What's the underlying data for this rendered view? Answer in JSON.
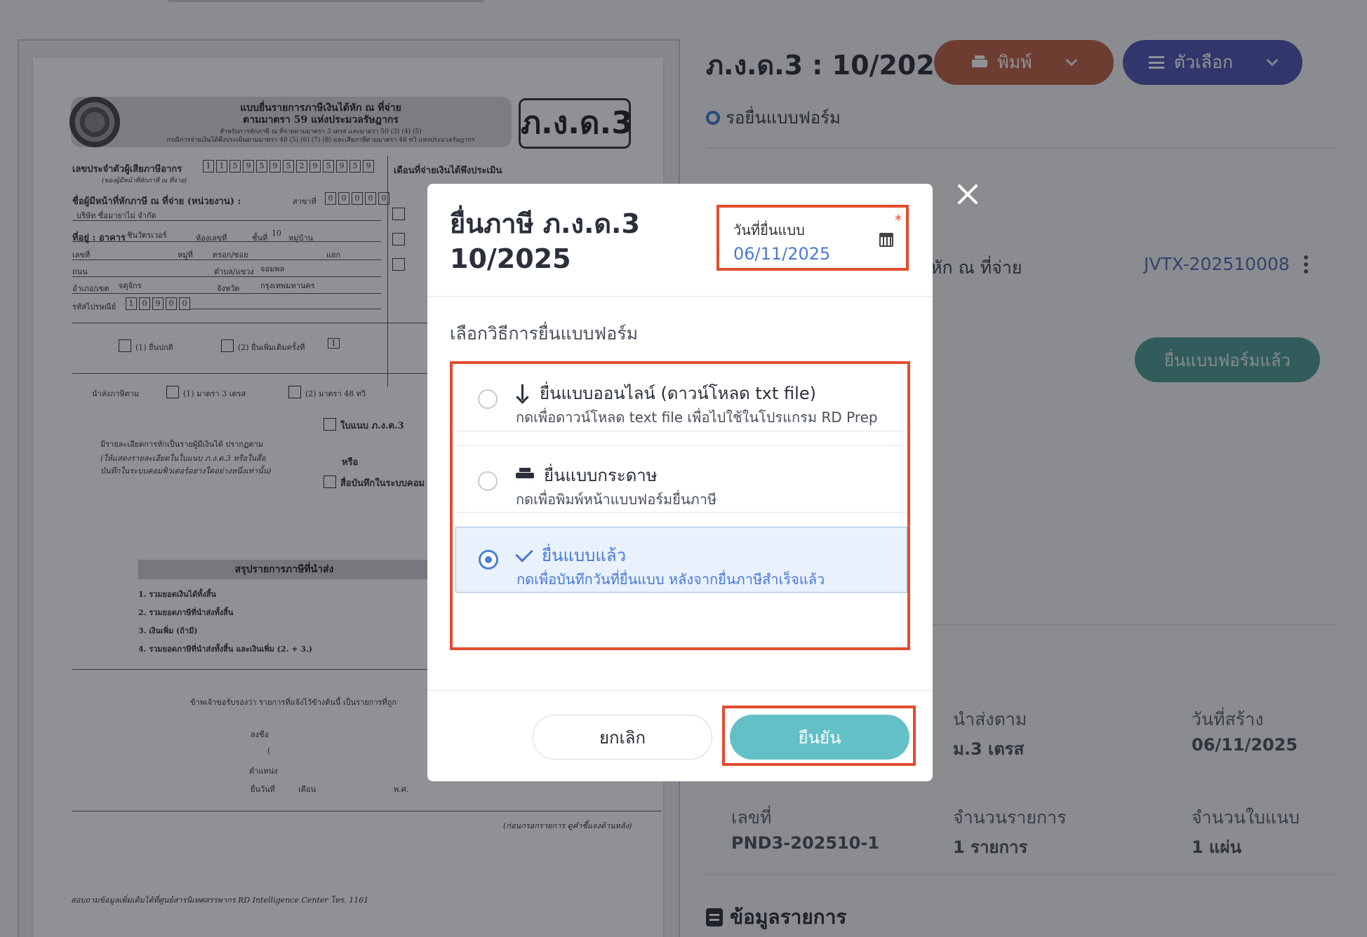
{
  "document": {
    "title_line1": "แบบยื่นรายการภาษีเงินได้หัก ณ ที่จ่าย",
    "title_line2": "ตามมาตรา 59 แห่งประมวลรัษฎากร",
    "sub_line1": "สำหรับการหักภาษี ณ ที่จ่ายตามมาตรา 3 เตรส และมาตรา 50 (3) (4) (5)",
    "sub_line2": "กรณีการจ่ายเงินได้พึงประเมินตามมาตรา 40 (5) (6) (7) (8) และเสียภาษีตามมาตรา 48 ทวิ แห่งประมวลรัษฎากร",
    "badge": "ภ.ง.ด.3",
    "taxid_label": "เลขประจำตัวผู้เสียภาษีอากร",
    "taxid_sub": "(ของผู้มีหน้าที่หักภาษี ณ ที่จ่าย)",
    "taxid_digits": [
      "1",
      "1",
      "5",
      "9",
      "5",
      "9",
      "5",
      "2",
      "9",
      "5",
      "9",
      "5",
      "9"
    ],
    "month_label": "เดือนที่จ่ายเงินได้พึงประเมิน",
    "payer_label": "ชื่อผู้มีหน้าที่หักภาษี ณ ที่จ่าย (หน่วยงาน) :",
    "branch_label": "สาขาที่",
    "branch_digits": [
      "0",
      "0",
      "0",
      "0",
      "0"
    ],
    "company_name": "บริษัท ซื่อมายาไม่ จำกัด",
    "address_label": "ที่อยู่ : อาคาร",
    "building": "ชินวัตรเวอร์",
    "room_label": "ห้องเลขที่",
    "floor_label": "ชั้นที่",
    "floor_value": "10",
    "village_label": "หมู่บ้าน",
    "no_label": "เลขที่",
    "moo_label": "หมู่ที่",
    "soi_label": "ตรอก/ซอย",
    "yaek_label": "แยก",
    "road_label": "ถนน",
    "subdistrict_label": "ตำบล/แขวง",
    "subdistrict_value": "จอมพล",
    "district_label": "อำเภอ/เขต",
    "district_value": "จตุจักร",
    "province_label": "จังหวัด",
    "province_value": "กรุงเทพมหานคร",
    "postcode_label": "รหัสไปรษณีย์",
    "postcode_digits": [
      "1",
      "0",
      "9",
      "0",
      "0"
    ],
    "normal_filing": "(1) ยื่นปกติ",
    "extra_filing": "(2) ยื่นเพิ่มเติมครั้งที่",
    "extra_count": "1",
    "remit_label": "นำส่งภาษีตาม",
    "remit_opt1": "(1) มาตรา 3 เตรส",
    "remit_opt2": "(2) มาตรา 48 ทวิ",
    "attach_label": "ใบแนบ ภ.ง.ด.3",
    "detail_line1": "มีรายละเอียดการหักเป็นรายผู้มีเงินได้ ปรากฏตาม",
    "detail_line2": "(ให้แสดงรายละเอียดในใบแนบ ภ.ง.ด.3 หรือในสื่อ",
    "detail_line3": "บันทึกในระบบคอมพิวเตอร์อย่างใดอย่างหนึ่งเท่านั้น)",
    "or_label": "หรือ",
    "media_label": "สื่อบันทึกในระบบคอม",
    "summary_title": "สรุปรายการภาษีที่นำส่ง",
    "sum1": "1. รวมยอดเงินได้ทั้งสิ้น",
    "sum2": "2. รวมยอดภาษีที่นำส่งทั้งสิ้น",
    "sum3": "3. เงินเพิ่ม (ถ้ามี)",
    "sum4": "4. รวมยอดภาษีที่นำส่งทั้งสิ้น และเงินเพิ่ม (2. + 3.)",
    "certify": "ข้าพเจ้าขอรับรองว่า รายการที่แจ้งไว้ข้างต้นนี้ เป็นรายการที่ถูก",
    "sign_label": "ลงชื่อ",
    "paren_open": "(",
    "position_label": "ตำแหน่ง",
    "date_label": "ยื่นวันที่",
    "month_word": "เดือน",
    "year_word": "พ.ศ.",
    "footnote": "(ก่อนกรอกรายการ ดูคำชี้แจงด้านหลัง)",
    "footer": "สอบถามข้อมูลเพิ่มเติมได้ที่ศูนย์สารนิเทศสรรพากร RD Intelligence Center โทร. 1161"
  },
  "header": {
    "title": "ภ.ง.ด.3 : 10/2025",
    "print_label": "พิมพ์",
    "options_label": "ตัวเลือก",
    "status": "รอยื่นแบบฟอร์ม"
  },
  "right": {
    "partial_text": "หัก ณ ที่จ่าย",
    "link": "JVTX-202510008",
    "filed_button": "ยื่นแบบฟอร์มแล้ว",
    "remit_label": "นำส่งตาม",
    "remit_value": "ม.3 เตรส",
    "created_label": "วันที่สร้าง",
    "created_value": "06/11/2025",
    "no_label": "เลขที่",
    "no_value": "PND3-202510-1",
    "items_label": "จำนวนรายการ",
    "items_value": "1 รายการ",
    "attach_label": "จำนวนใบแนบ",
    "attach_value": "1 แผ่น",
    "section_title": "ข้อมูลรายการ"
  },
  "modal": {
    "title_line1": "ยื่นภาษี ภ.ง.ด.3",
    "title_line2": "10/2025",
    "date_label": "วันที่ยื่นแบบ",
    "required_mark": "*",
    "date_value": "06/11/2025",
    "subtitle": "เลือกวิธีการยื่นแบบฟอร์ม",
    "options": [
      {
        "title": "ยื่นแบบออนไลน์ (ดาวน์โหลด txt file)",
        "desc": "กดเพื่อดาวน์โหลด text file เพื่อไปใช้ในโปรแกรม RD Prep",
        "icon": "download-icon"
      },
      {
        "title": "ยื่นแบบกระดาษ",
        "desc": "กดเพื่อพิมพ์หน้าแบบฟอร์มยื่นภาษี",
        "icon": "printer-icon"
      },
      {
        "title": "ยื่นแบบแล้ว",
        "desc": "กดเพื่อบันทึกวันที่ยื่นแบบ หลังจากยื่นภาษีสำเร็จแล้ว",
        "icon": "check-icon"
      }
    ],
    "selected_option": 2,
    "cancel_label": "ยกเลิก",
    "confirm_label": "ยืนยัน"
  },
  "colors": {
    "highlight_red": "#e34c2f",
    "print_button": "#bf6147",
    "options_button": "#4d56b4",
    "confirm_button": "#64c0c7",
    "filed_button": "#4e9b96",
    "selected_blue": "#4a79d6"
  }
}
